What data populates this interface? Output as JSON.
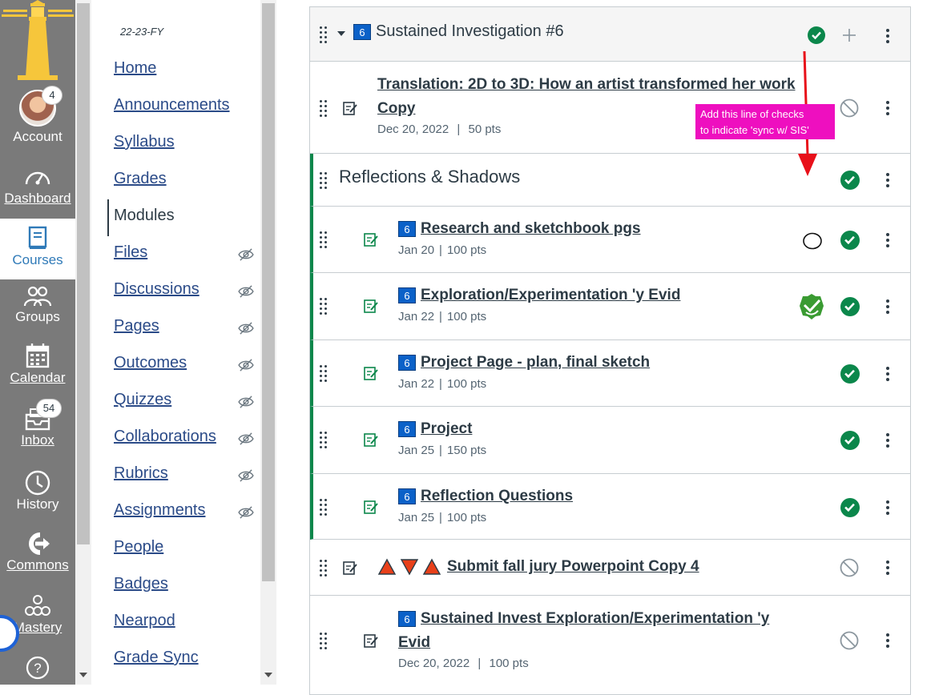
{
  "global_nav": {
    "account": {
      "label": "Account",
      "badge": "4"
    },
    "dashboard": {
      "label": "Dashboard"
    },
    "courses": {
      "label": "Courses"
    },
    "groups": {
      "label": "Groups"
    },
    "calendar": {
      "label": "Calendar"
    },
    "inbox": {
      "label": "Inbox",
      "badge": "54"
    },
    "history": {
      "label": "History"
    },
    "commons": {
      "label": "Commons"
    },
    "mastery": {
      "label": "Mastery"
    },
    "help": {
      "icon": "help-icon"
    }
  },
  "course_nav": {
    "term": "22-23-FY",
    "items": [
      {
        "label": "Home",
        "hidden": false
      },
      {
        "label": "Announcements",
        "hidden": false
      },
      {
        "label": "Syllabus",
        "hidden": false
      },
      {
        "label": "Grades",
        "hidden": false
      },
      {
        "label": "Modules",
        "hidden": false,
        "active": true
      },
      {
        "label": "Files",
        "hidden": true
      },
      {
        "label": "Discussions",
        "hidden": true
      },
      {
        "label": "Pages",
        "hidden": true
      },
      {
        "label": "Outcomes",
        "hidden": true
      },
      {
        "label": "Quizzes",
        "hidden": true
      },
      {
        "label": "Collaborations",
        "hidden": true
      },
      {
        "label": "Rubrics",
        "hidden": true
      },
      {
        "label": "Assignments",
        "hidden": true
      },
      {
        "label": "People",
        "hidden": false
      },
      {
        "label": "Badges",
        "hidden": false
      },
      {
        "label": "Nearpod",
        "hidden": false
      },
      {
        "label": "Grade Sync",
        "hidden": false
      }
    ]
  },
  "module": {
    "badge": "6",
    "title": "Sustained Investigation #6",
    "items": [
      {
        "title_line1": "Translation: 2D to 3D: How an artist transformed her work",
        "title_line2": "Copy",
        "date": "Dec 20, 2022",
        "points": "50 pts",
        "published": false
      },
      {
        "subheader": "Reflections & Shadows",
        "published": true
      },
      {
        "badge": "6",
        "title": "Research and sketchbook pgs",
        "date": "Jan 20",
        "points": "100 pts",
        "published": true
      },
      {
        "badge": "6",
        "title": "Exploration/Experimentation 'y Evid",
        "date": "Jan 22",
        "points": "100 pts",
        "published": true
      },
      {
        "badge": "6",
        "title": "Project Page - plan, final sketch",
        "date": "Jan 22",
        "points": "100 pts",
        "published": true
      },
      {
        "badge": "6",
        "title": "Project",
        "date": "Jan 25",
        "points": "150 pts",
        "published": true
      },
      {
        "badge": "6",
        "title": "Reflection Questions",
        "date": "Jan 25",
        "points": "100 pts",
        "published": true
      },
      {
        "title": "Submit fall jury Powerpoint Copy 4",
        "published": false
      },
      {
        "badge": "6",
        "title_line1": "Sustained Invest Exploration/Experimentation 'y",
        "title_line2": "Evid",
        "date": "Dec 20, 2022",
        "points": "100 pts",
        "published": false
      }
    ],
    "separator": "|"
  },
  "callout": {
    "line1": "Add this line of checks",
    "line2": "to indicate 'sync w/ SIS'"
  },
  "colors": {
    "nav_bg": "#7a7a7a",
    "link": "#2b4b88",
    "published_green": "#0b874b",
    "badge_blue": "#0b61c8",
    "callout_pink": "#ee0fbf",
    "arrow_red": "#e8101a"
  }
}
